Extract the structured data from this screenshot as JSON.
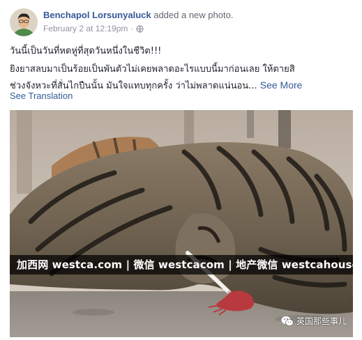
{
  "post": {
    "author": "Benchapol Lorsunyaluck",
    "action": "added a new photo.",
    "timestamp": "February 2 at 12:19pm",
    "separator": "·",
    "privacy_icon": "globe-icon",
    "text_line_1": "วันนี้เป็นวันที่หดหู่ที่สุดวันหนึ่งในชีวิต!!!",
    "text_line_2": "ยิงยาสลบมาเป็นร้อยเป็นพันตัวไม่เคยพลาดอะไรแบบนี้มาก่อนเลย ให้ตายสิ",
    "text_line_3": "ช่วงจังหวะที่สั่นไกปืนนั้น มันใจแทบทุกครั้ง ว่าไม่พลาดแน่นอน...",
    "see_more": "See More",
    "see_translation": "See Translation"
  },
  "photo": {
    "subject": "tiger lying down with tranquilizer dart",
    "watermark": "加西网 westca.com | 微信 westcacom | 地产微信 westcahouse",
    "wechat_badge": "英国那些事儿",
    "wechat_icon": "wechat-icon"
  },
  "colors": {
    "link": "#365899",
    "meta": "#90949c",
    "body_text": "#1d2129"
  }
}
